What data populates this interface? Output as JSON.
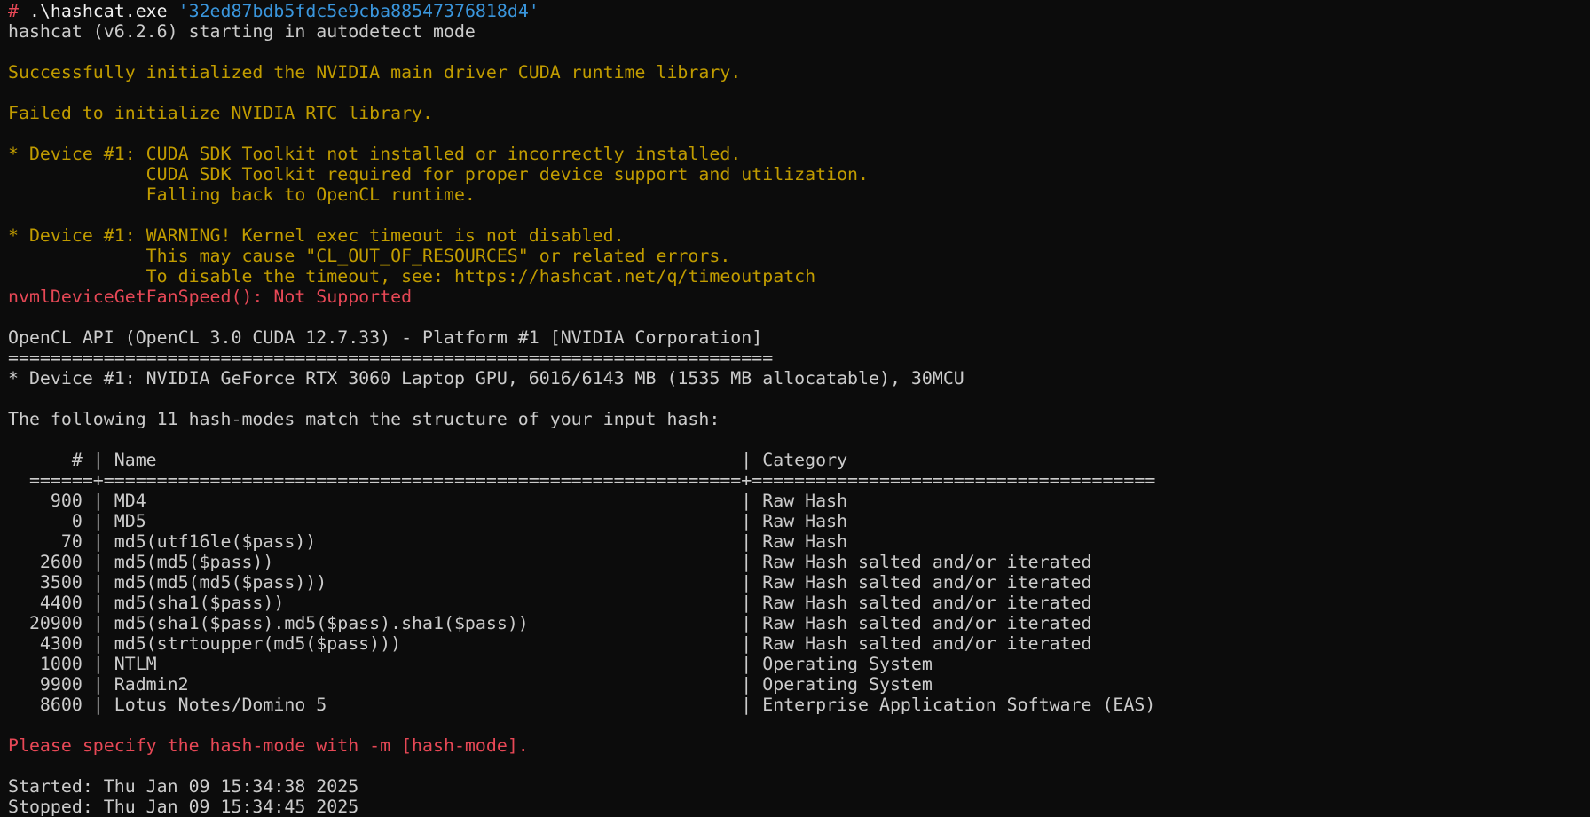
{
  "colors": {
    "background": "#0c0c0c",
    "text": "#cccccc",
    "prompt": "#e74856",
    "string_arg": "#3a96dd",
    "warning": "#c19c00",
    "error": "#e74856"
  },
  "prompt": {
    "symbol": "#",
    "command": " .\\hashcat.exe ",
    "argument": "'32ed87bdb5fdc5e9cba88547376818d4'"
  },
  "output": {
    "start": "hashcat (v6.2.6) starting in autodetect mode",
    "cuda_ok": "Successfully initialized the NVIDIA main driver CUDA runtime library.",
    "rtc_fail": "Failed to initialize NVIDIA RTC library.",
    "sdk_1": "* Device #1: CUDA SDK Toolkit not installed or incorrectly installed.",
    "sdk_2": "             CUDA SDK Toolkit required for proper device support and utilization.",
    "sdk_3": "             Falling back to OpenCL runtime.",
    "timeout_1": "* Device #1: WARNING! Kernel exec timeout is not disabled.",
    "timeout_2": "             This may cause \"CL_OUT_OF_RESOURCES\" or related errors.",
    "timeout_3": "             To disable the timeout, see: https://hashcat.net/q/timeoutpatch",
    "fan_error": "nvmlDeviceGetFanSpeed(): Not Supported",
    "opencl_api": "OpenCL API (OpenCL 3.0 CUDA 12.7.33) - Platform #1 [NVIDIA Corporation]",
    "opencl_rule": "========================================================================",
    "device": "* Device #1: NVIDIA GeForce RTX 3060 Laptop GPU, 6016/6143 MB (1535 MB allocatable), 30MCU",
    "match_intro": "The following 11 hash-modes match the structure of your input hash:",
    "table_header": "      # | Name                                                       | Category",
    "table_rule": "  ======+============================================================+======================================",
    "table_rows": [
      "    900 | MD4                                                        | Raw Hash",
      "      0 | MD5                                                        | Raw Hash",
      "     70 | md5(utf16le($pass))                                        | Raw Hash",
      "   2600 | md5(md5($pass))                                            | Raw Hash salted and/or iterated",
      "   3500 | md5(md5(md5($pass)))                                       | Raw Hash salted and/or iterated",
      "   4400 | md5(sha1($pass))                                           | Raw Hash salted and/or iterated",
      "  20900 | md5(sha1($pass).md5($pass).sha1($pass))                    | Raw Hash salted and/or iterated",
      "   4300 | md5(strtoupper(md5($pass)))                                | Raw Hash salted and/or iterated",
      "   1000 | NTLM                                                       | Operating System",
      "   9900 | Radmin2                                                    | Operating System",
      "   8600 | Lotus Notes/Domino 5                                       | Enterprise Application Software (EAS)"
    ],
    "specify_mode": "Please specify the hash-mode with -m [hash-mode].",
    "started": "Started: Thu Jan 09 15:34:38 2025",
    "stopped": "Stopped: Thu Jan 09 15:34:45 2025"
  }
}
